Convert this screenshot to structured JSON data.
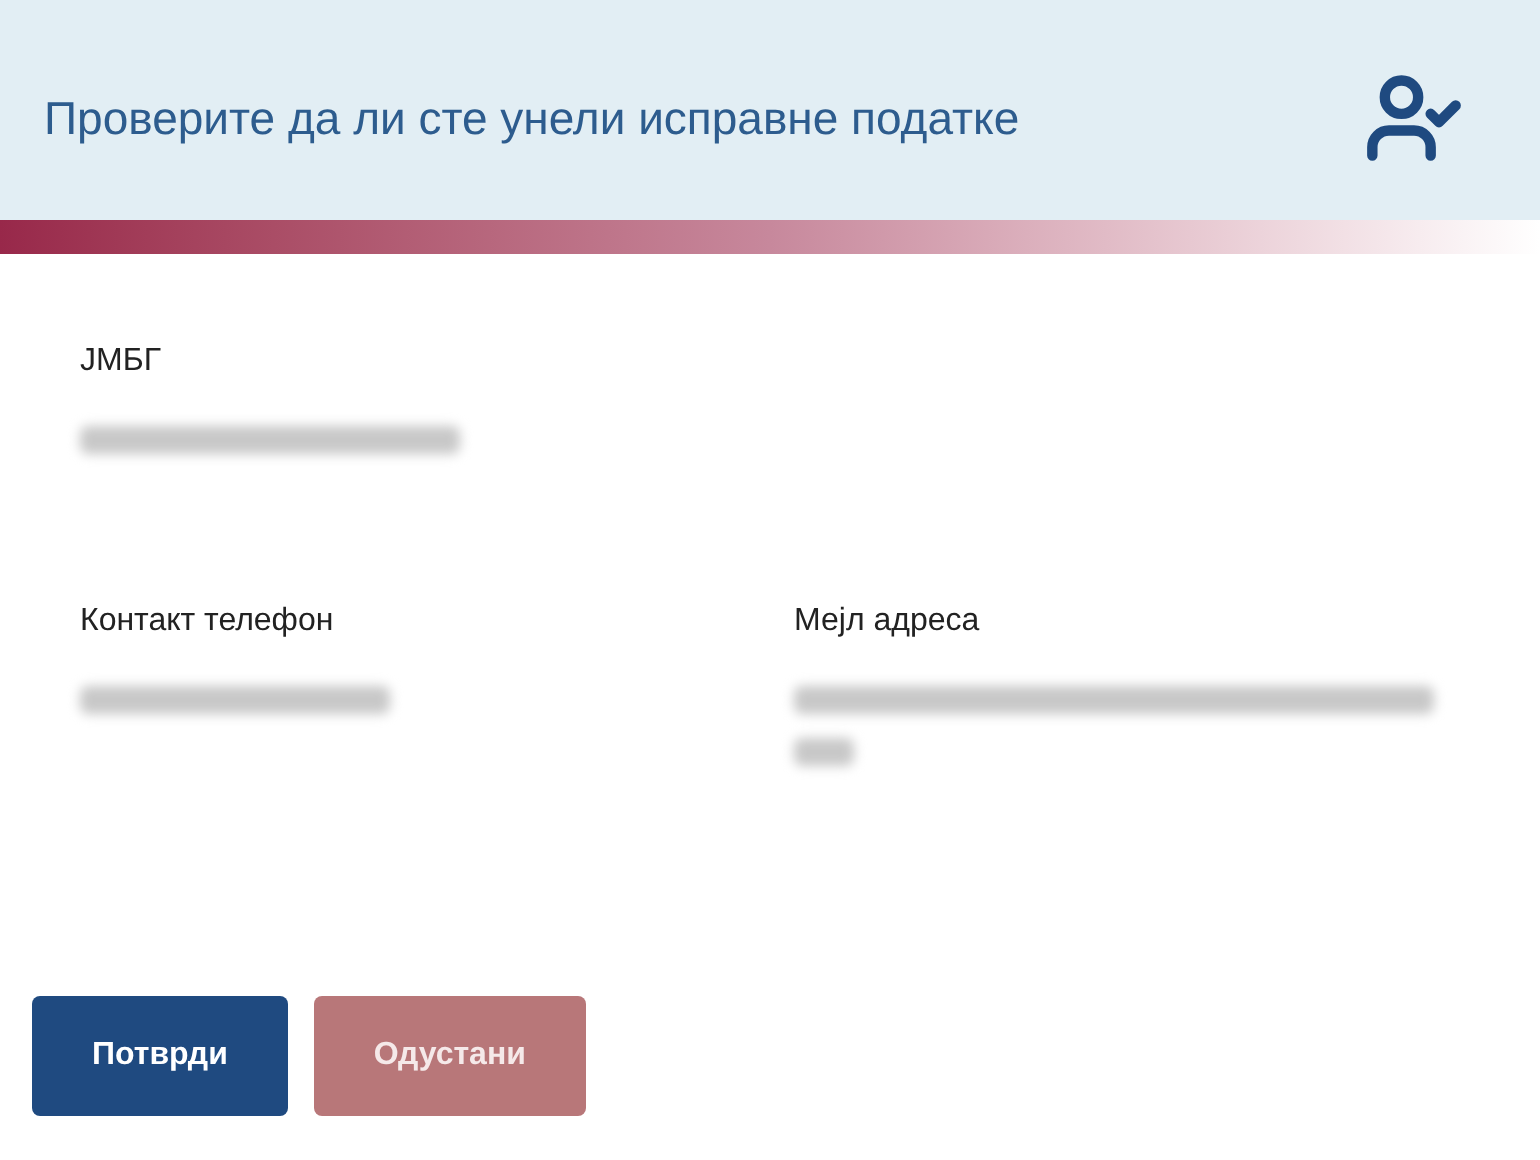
{
  "header": {
    "title": "Проверите да ли сте унели исправне податке"
  },
  "fields": [
    {
      "label": "ЈМБГ",
      "redacted": true
    },
    {
      "label": "Контакт телефон",
      "redacted": true
    },
    {
      "label": "Мејл адреса",
      "redacted": true
    }
  ],
  "buttons": [
    {
      "label": "Потврди",
      "kind": "primary"
    },
    {
      "label": "Одустани",
      "kind": "secondary"
    }
  ]
}
